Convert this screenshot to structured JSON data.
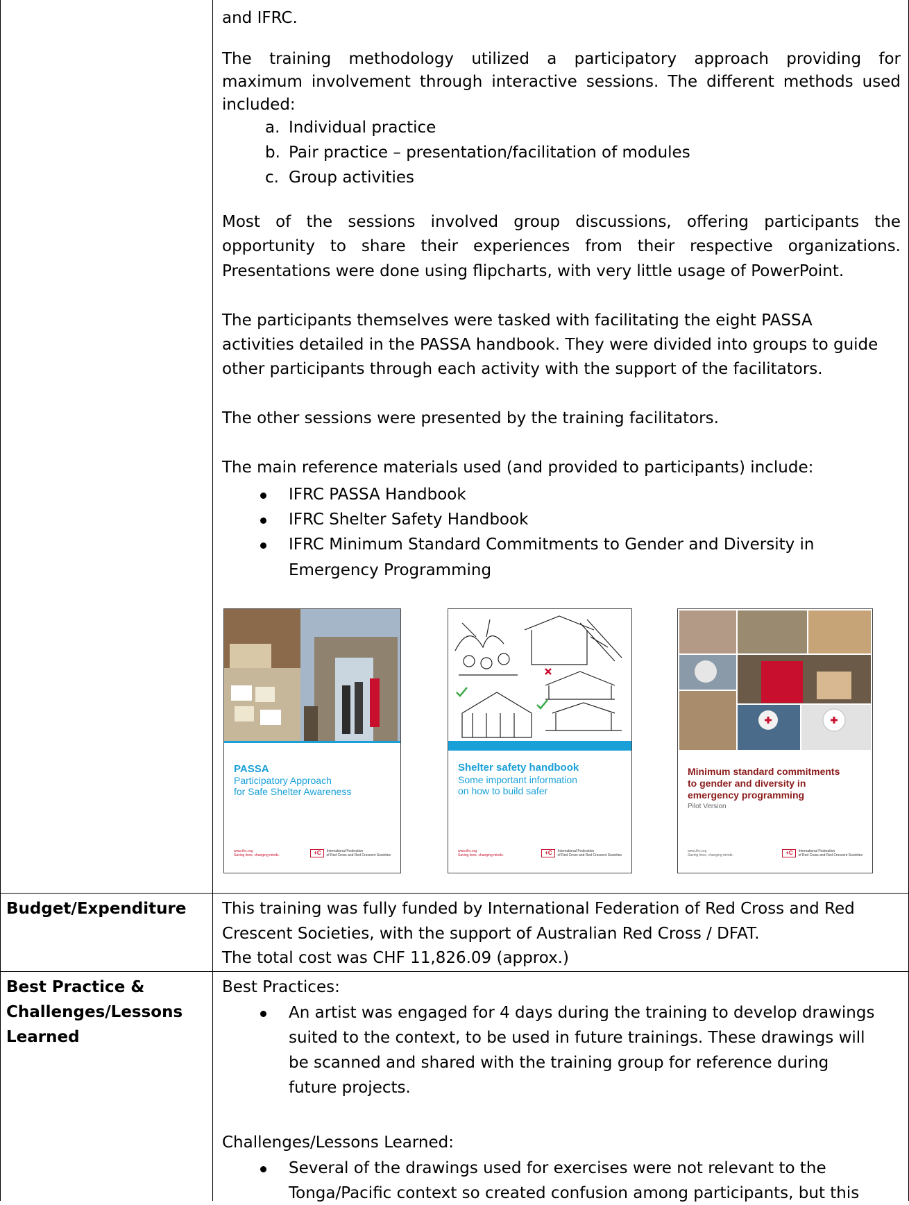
{
  "top": {
    "line0": "and IFRC.",
    "methodology": [
      "The training methodology utilized a participatory approach providing for",
      "maximum involvement through interactive sessions. The different methods used",
      "included:"
    ],
    "methods": [
      {
        "marker": "a.",
        "text": "Individual practice"
      },
      {
        "marker": "b.",
        "text": "Pair practice – presentation/facilitation of modules"
      },
      {
        "marker": "c.",
        "text": "Group activities"
      }
    ],
    "sessions": [
      "Most of the sessions involved group discussions, offering participants the",
      "opportunity to share their experiences from their respective organizations.",
      "Presentations were done using flipcharts, with very little usage of PowerPoint."
    ],
    "participants": [
      "The participants themselves were tasked with facilitating the eight PASSA",
      "activities detailed in the PASSA handbook. They were divided into groups to guide",
      "other participants through each activity with the support of the facilitators."
    ],
    "other_sessions": "The other sessions were presented by the training facilitators.",
    "materials_intro": "The main reference materials used (and provided to participants) include:",
    "materials": [
      "IFRC PASSA Handbook",
      "IFRC Shelter Safety Handbook",
      "IFRC Minimum Standard Commitments to Gender and Diversity in",
      "Emergency Programming"
    ]
  },
  "covers": [
    {
      "title": "PASSA",
      "sub": [
        "Participatory Approach",
        "for Safe Shelter Awareness"
      ],
      "footer_left": [
        "www.ifrc.org",
        "Saving lives, changing minds."
      ],
      "footer_right": [
        "International Federation",
        "of Red Cross and Red Crescent Societies"
      ],
      "accent": "#1aa0d8"
    },
    {
      "title": "Shelter safety handbook",
      "sub": [
        "Some important information",
        "on how to build safer"
      ],
      "footer_left": [
        "www.ifrc.org",
        "Saving lives, changing minds."
      ],
      "footer_right": [
        "International Federation",
        "of Red Cross and Red Crescent Societies"
      ],
      "accent": "#1aa0d8"
    },
    {
      "title_lines": [
        "Minimum standard commitments",
        "to gender and diversity in",
        "emergency programming"
      ],
      "pilot": "Pilot Version",
      "footer_left": [
        "www.ifrc.org",
        "Saving lives, changing minds."
      ],
      "footer_right": [
        "International Federation",
        "of Red Cross and Red Crescent Societies"
      ],
      "accent": "#8b1a1a"
    }
  ],
  "budget": {
    "label": "Budget/Expenditure",
    "lines": [
      "This training was fully funded by International Federation of Red Cross and Red",
      "Crescent Societies, with the support of Australian Red Cross / DFAT.",
      "The total cost was CHF 11,826.09 (approx.)"
    ]
  },
  "best": {
    "label": [
      "Best Practice &",
      "Challenges/Lessons",
      "Learned"
    ],
    "bp_heading": "Best Practices:",
    "bp_lines": [
      "An artist was engaged for 4 days during the training to develop drawings",
      "suited to the context, to be used in future trainings. These drawings will",
      "be scanned and shared with the training group for reference during",
      "future projects."
    ],
    "cl_heading": "Challenges/Lessons Learned:",
    "cl_lines": [
      "Several of the drawings used for exercises were not relevant to the",
      "Tonga/Pacific context so created confusion among participants, but this"
    ]
  }
}
